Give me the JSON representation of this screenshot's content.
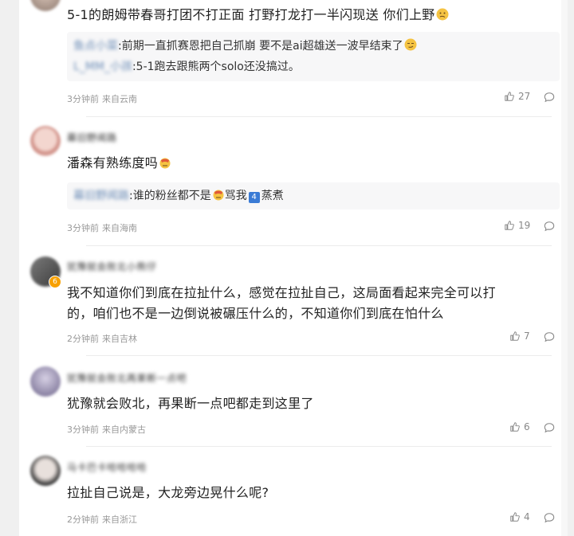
{
  "colors": {
    "background": "#f0f0f0",
    "card": "#ffffff",
    "reply_bg": "#f7f7f8",
    "reply_name": "#6f8fb8",
    "meta_text": "#999999"
  },
  "comments": [
    {
      "content": "5-1的朗姆带春哥打团不打正面 打野打龙打一半闪现送 你们上野",
      "content_emoji": "confused-face-emoji",
      "replies": [
        {
          "name": "鱼点小菜",
          "text": ":前期一直抓赛恩把自己抓崩 要不是ai超雄送一波早结束了",
          "emoji": "smirk-face-emoji"
        },
        {
          "name": "L_MM_小孩",
          "text": ":5-1跑去跟熊两个solo还没搞过。"
        }
      ],
      "time": "3分钟前",
      "location": "来自云南",
      "likes": "27"
    },
    {
      "username": "幕旧野闻路",
      "content": "潘森有熟练度吗",
      "content_emoji": "facepalm-emoji",
      "replies": [
        {
          "name": "幕旧野闻路",
          "text": ":谁的粉丝都不是",
          "emoji": "facepalm-emoji",
          "text2": "骂我",
          "badge": "4",
          "text3": "蒸煮"
        }
      ],
      "time": "3分钟前",
      "location": "来自海南",
      "likes": "19"
    },
    {
      "username": "犹豫就会败北小熊仔",
      "badge": "6",
      "content": "我不知道你们到底在拉扯什么，感觉在拉扯自己，这局面看起来完全可以打的，咱们也不是一边倒说被碾压什么的，不知道你们到底在怕什么",
      "time": "2分钟前",
      "location": "来自吉林",
      "likes": "7"
    },
    {
      "username": "犹豫就会败北再果断一点吧",
      "content": "犹豫就会败北，再果断一点吧都走到这里了",
      "time": "3分钟前",
      "location": "来自内蒙古",
      "likes": "6"
    },
    {
      "username": "马卡巴卡哈哈哈哈",
      "content": "拉扯自己说是，大龙旁边晃什么呢?",
      "time": "2分钟前",
      "location": "来自浙江",
      "likes": "4"
    }
  ]
}
